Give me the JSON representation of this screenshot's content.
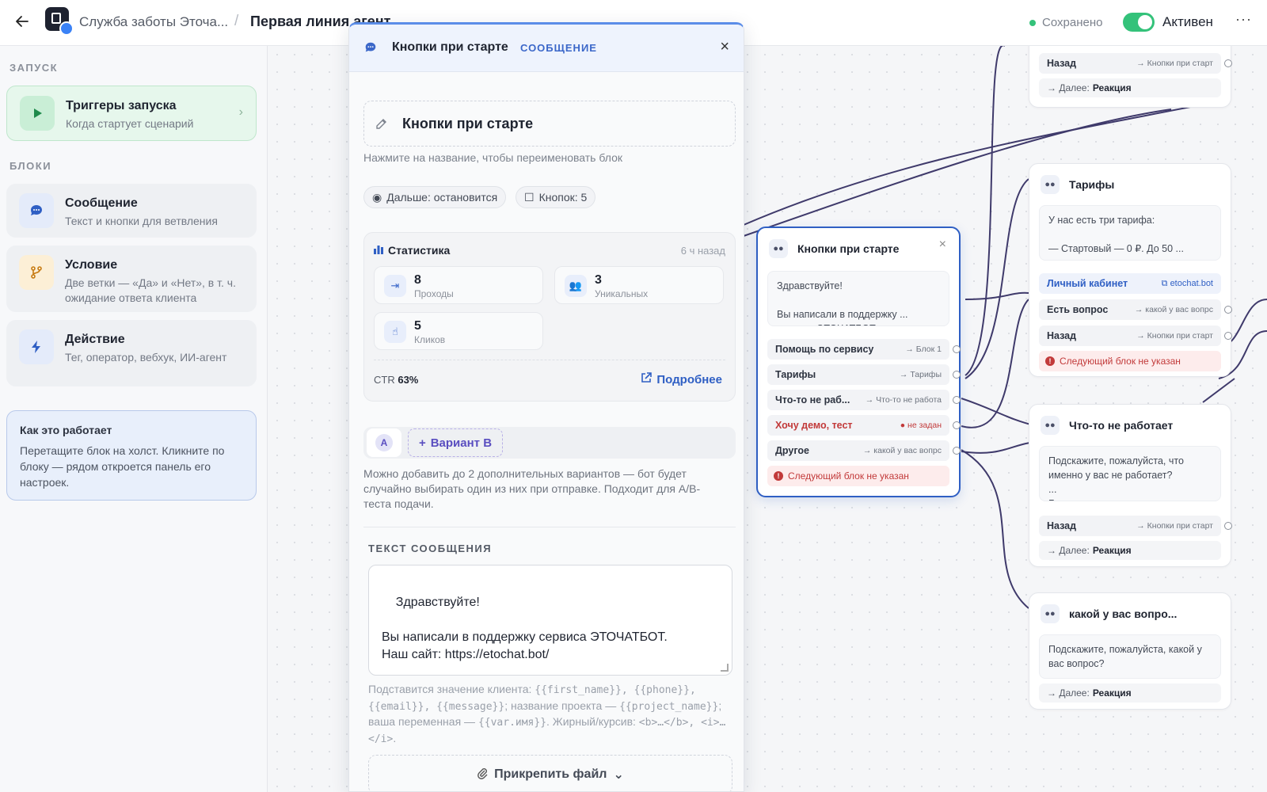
{
  "topbar": {
    "project_name": "Служба заботы Эточа...",
    "separator": "/",
    "flow_name": "Первая линия агент",
    "saved_label": "Сохранено",
    "active_label": "Активен",
    "more": "···"
  },
  "sidebar": {
    "section_launch": "ЗАПУСК",
    "trigger": {
      "title": "Триггеры запуска",
      "subtitle": "Когда стартует сценарий"
    },
    "section_blocks": "БЛОКИ",
    "blocks": [
      {
        "title": "Сообщение",
        "subtitle": "Текст и кнопки для ветвления"
      },
      {
        "title": "Условие",
        "subtitle": "Две ветки — «Да» и «Нет», в т. ч. ожидание ответа клиента"
      },
      {
        "title": "Действие",
        "subtitle": "Тег, оператор, вебхук, ИИ-агент"
      }
    ],
    "help": {
      "title": "Как это работает",
      "body": "Перетащите блок на холст. Кликните по блоку — рядом откроется панель его настроек."
    }
  },
  "panel": {
    "title": "Кнопки при старте",
    "kind": "СООБЩЕНИЕ",
    "close": "×",
    "name_value": "Кнопки при старте",
    "name_hint": "Нажмите на название, чтобы переименовать блок",
    "pill_next": "Дальше: остановится",
    "pill_buttons": "Кнопок: 5",
    "stats": {
      "title": "Статистика",
      "ago": "6 ч назад",
      "passes": {
        "value": "8",
        "label": "Проходы"
      },
      "unique": {
        "value": "3",
        "label": "Уникальных"
      },
      "clicks": {
        "value": "5",
        "label": "Кликов"
      },
      "ctr_label": "CTR",
      "ctr_value": "63%",
      "more": "Подробнее"
    },
    "variant_a": "A",
    "variant_b": "Вариант B",
    "variant_hint": "Можно добавить до 2 дополнительных вариантов — бот будет случайно выбирать один из них при отправке. Подходит для A/B-теста подачи.",
    "text_label": "ТЕКСТ СООБЩЕНИЯ",
    "text_value": "Здравствуйте!\n\nВы написали в поддержку сервиса ЭТОЧАТБОТ.\nНаш сайт: https://etochat.bot/\n\nЗдесь вы можете задать вопрос, сообщить об ошибке",
    "vars_help_1": "Подставится значение клиента: ",
    "vars_help_code_1": "{{first_name}}, {{phone}}, {{email}}, {{message}}",
    "vars_help_2": "; название проекта — ",
    "vars_help_code_2": "{{project_name}}",
    "vars_help_3": "; ваша переменная — ",
    "vars_help_code_3": "{{var.имя}}",
    "vars_help_4": ". Жирный/курсив: ",
    "vars_help_code_4": "<b>…</b>, <i>…</i>",
    "vars_help_5": ".",
    "attach": "Прикрепить файл"
  },
  "nodes": {
    "top_right": {
      "back_label": "Назад",
      "back_target": "→ Кнопки при старт",
      "next_prefix": "→ Далее:",
      "next_value": "Реакция"
    },
    "start": {
      "title": "Кнопки при старте",
      "close": "×",
      "preview": "Здравствуйте!\n\nВы написали в поддержку ...\nсервиса ЭТОЧАТБОТ",
      "rows": [
        {
          "label": "Помощь по сервису",
          "target": "→ Блок 1"
        },
        {
          "label": "Тарифы",
          "target": "→ Тарифы"
        },
        {
          "label": "Что-то не раб...",
          "target": "→ Что-то не работа"
        },
        {
          "label": "Хочу демо, тест",
          "target": "не задан"
        },
        {
          "label": "Другое",
          "target": "→ какой у вас вопрс"
        }
      ],
      "warning": "Следующий блок не указан"
    },
    "tariffs": {
      "title": "Тарифы",
      "preview": "У нас есть три тарифа:\n\n— Стартовый — 0 ₽. До 50 ...\nдиалогов в месяц, для теста",
      "link_label": "Личный кабинет",
      "link_target": "etochat.bot",
      "rows": [
        {
          "label": "Есть вопрос",
          "target": "→ какой у вас вопрс"
        },
        {
          "label": "Назад",
          "target": "→ Кнопки при старт"
        }
      ],
      "warning": "Следующий блок не указан"
    },
    "broken": {
      "title": "Что-то не работает",
      "preview": "Подскажите, пожалуйста, что именно у вас не работает?\n...\nБудет здорово, если вы сможете",
      "back_label": "Назад",
      "back_target": "→ Кнопки при старт",
      "next_prefix": "→ Далее:",
      "next_value": "Реакция"
    },
    "question": {
      "title": "какой у вас вопро...",
      "preview": "Подскажите, пожалуйста, какой у вас вопрос?",
      "next_prefix": "→ Далее:",
      "next_value": "Реакция"
    }
  }
}
